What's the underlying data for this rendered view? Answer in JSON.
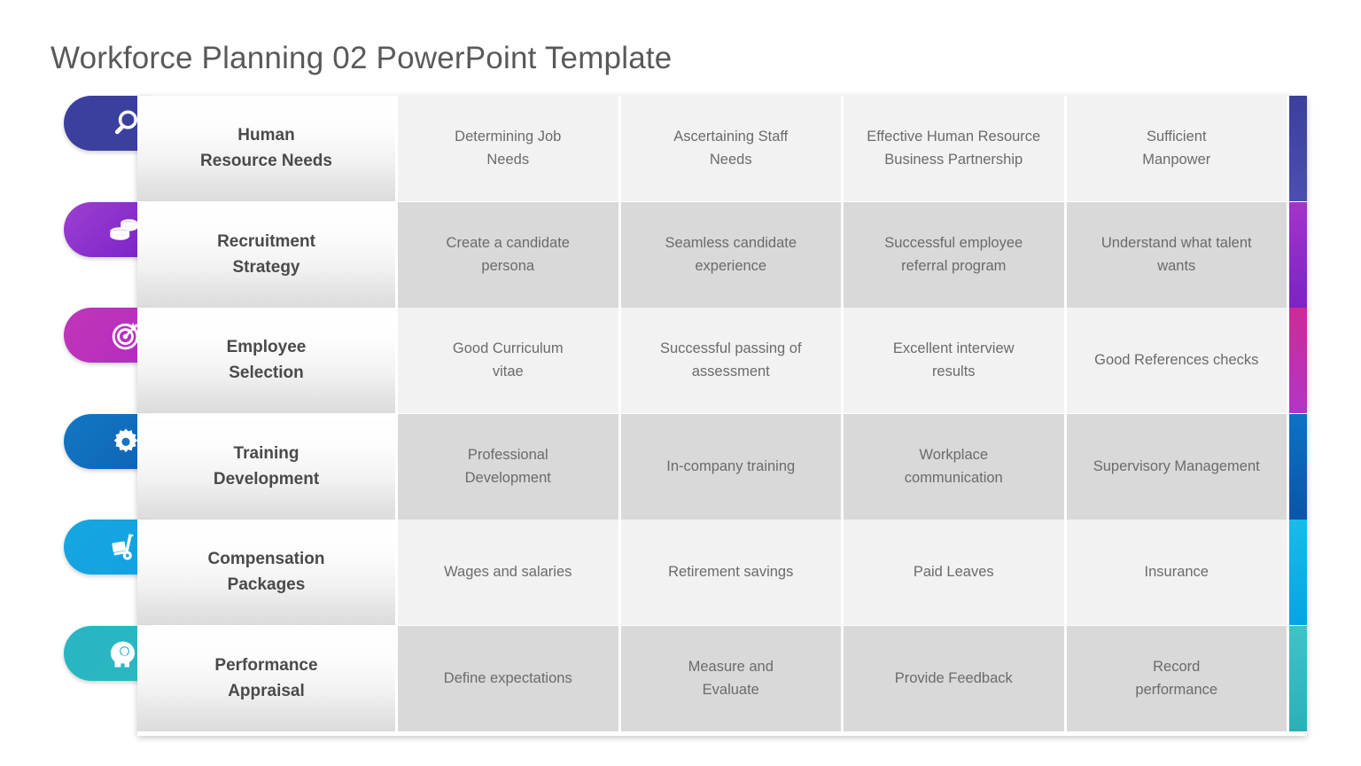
{
  "title": "Workforce Planning 02 PowerPoint Template",
  "rows": [
    {
      "label": "Human\nResource Needs",
      "icon": "magnifier-icon",
      "pill_gradient": [
        "#3b3f9e",
        "#3b3f9e"
      ],
      "accent_gradient": [
        "#3c3f9c",
        "#4b4fae"
      ],
      "cells": [
        "Determining Job\nNeeds",
        "Ascertaining Staff\nNeeds",
        "Effective Human Resource\nBusiness Partnership",
        "Sufficient\nManpower"
      ]
    },
    {
      "label": "Recruitment\nStrategy",
      "icon": "coins-stack-icon",
      "pill_gradient": [
        "#9c3fd1",
        "#7b22c7"
      ],
      "accent_gradient": [
        "#a334c9",
        "#7b23c6"
      ],
      "cells": [
        "Create a candidate\npersona",
        "Seamless candidate\nexperience",
        "Successful employee\nreferral program",
        "Understand what talent\nwants"
      ]
    },
    {
      "label": "Employee\nSelection",
      "icon": "target-icon",
      "pill_gradient": [
        "#c036b8",
        "#b52cc0"
      ],
      "accent_gradient": [
        "#cc2b96",
        "#b235c6"
      ],
      "cells": [
        "Good Curriculum\nvitae",
        "Successful passing of\nassessment",
        "Excellent interview\nresults",
        "Good References checks"
      ]
    },
    {
      "label": "Training\nDevelopment",
      "icon": "gear-icon",
      "pill_gradient": [
        "#1378c4",
        "#0f63b4"
      ],
      "accent_gradient": [
        "#0d72c4",
        "#0a55a8"
      ],
      "cells": [
        "Professional\nDevelopment",
        "In-company training",
        "Workplace\ncommunication",
        "Supervisory Management"
      ]
    },
    {
      "label": "Compensation\nPackages",
      "icon": "hand-truck-icon",
      "pill_gradient": [
        "#16a6e0",
        "#13a2e2"
      ],
      "accent_gradient": [
        "#18bbea",
        "#06a4e2"
      ],
      "cells": [
        "Wages and salaries",
        "Retirement savings",
        "Paid Leaves",
        "Insurance"
      ]
    },
    {
      "label": "Performance\nAppraisal",
      "icon": "head-lightbulb-icon",
      "pill_gradient": [
        "#28b5c4",
        "#2ab8c0"
      ],
      "accent_gradient": [
        "#3fc3c9",
        "#2bb0b8"
      ],
      "cells": [
        "Define expectations",
        "Measure and\nEvaluate",
        "Provide Feedback",
        "Record\nperformance"
      ]
    }
  ]
}
